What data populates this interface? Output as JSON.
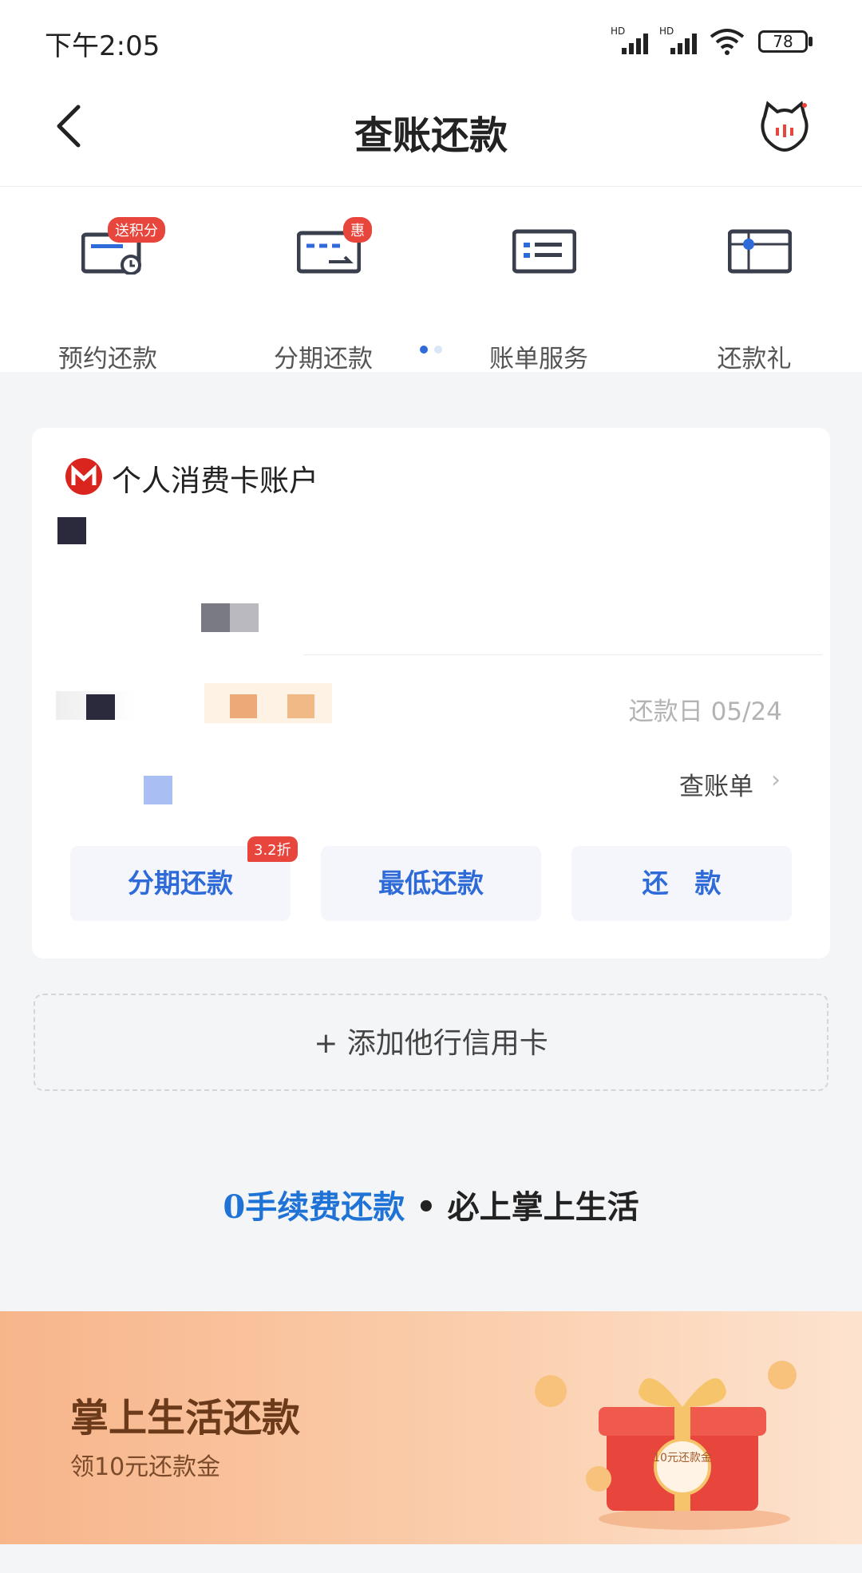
{
  "status_bar": {
    "time": "下午2:05",
    "battery": "78",
    "signal_label_1": "HD",
    "signal_label_2": "HD"
  },
  "nav": {
    "title": "查账还款"
  },
  "quick_menu": {
    "items": [
      {
        "label": "预约还款",
        "badge": "送积分"
      },
      {
        "label": "分期还款",
        "badge": "惠"
      },
      {
        "label": "账单服务"
      },
      {
        "label": "还款礼"
      }
    ]
  },
  "account_card": {
    "title": "个人消费卡账户",
    "due_date": "还款日 05/24",
    "view_bill": "查账单",
    "buttons": [
      {
        "label": "分期还款",
        "badge": "3.2折"
      },
      {
        "label": "最低还款"
      },
      {
        "label": "还　款"
      }
    ]
  },
  "add_card": {
    "label": "+ 添加他行信用卡"
  },
  "slogan": {
    "highlight": "0手续费还款",
    "separator": " • ",
    "rest": "必上掌上生活"
  },
  "banner": {
    "title": "掌上生活还款",
    "subtitle": "领10元还款金",
    "gift_text": "10元还款金"
  },
  "colors": {
    "accent_blue": "#2f6bd8",
    "badge_red": "#e8463c"
  }
}
